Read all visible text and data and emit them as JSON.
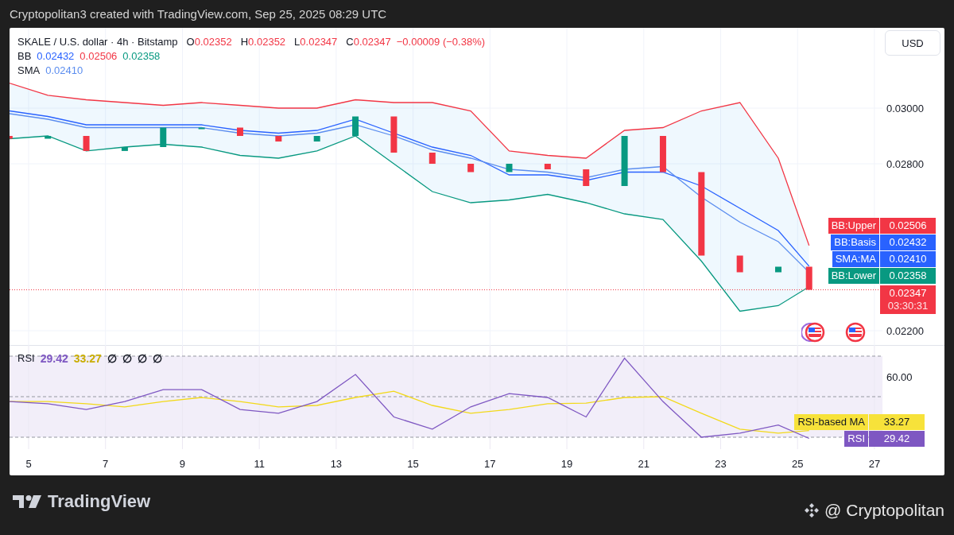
{
  "header": {
    "text": "Cryptopolitan3 created with TradingView.com, Sep 25, 2025 08:29 UTC"
  },
  "legend": {
    "symbol": "SKALE / U.S. dollar · 4h · Bitstamp",
    "ohlc": [
      {
        "label": "O",
        "value": "0.02352"
      },
      {
        "label": "H",
        "value": "0.02352"
      },
      {
        "label": "L",
        "value": "0.02347"
      },
      {
        "label": "C",
        "value": "0.02347"
      }
    ],
    "change": "−0.00009 (−0.38%)",
    "indicators": [
      {
        "name": "BB",
        "values": [
          {
            "text": "0.02432",
            "color": "#2962ff"
          },
          {
            "text": "0.02506",
            "color": "#f23645"
          },
          {
            "text": "0.02358",
            "color": "#089981"
          }
        ]
      },
      {
        "name": "SMA",
        "values": [
          {
            "text": "0.02410",
            "color": "#5b8def"
          }
        ]
      }
    ]
  },
  "currency": "USD",
  "price_axis": [
    "0.03000",
    "0.02800",
    "0.02200"
  ],
  "price_labels": [
    {
      "name": "BB:Upper",
      "value": "0.02506",
      "color": "#f23645"
    },
    {
      "name": "BB:Basis",
      "value": "0.02432",
      "color": "#2962ff"
    },
    {
      "name": "SMA:MA",
      "value": "0.02410",
      "color": "#2962ff"
    },
    {
      "name": "BB:Lower",
      "value": "0.02358",
      "color": "#089981"
    }
  ],
  "last_price": {
    "value": "0.02347",
    "countdown": "03:30:31"
  },
  "rsi": {
    "legend": {
      "name": "RSI",
      "values": [
        {
          "text": "29.42",
          "color": "#7e57c2"
        },
        {
          "text": "33.27",
          "color": "#c9ad00"
        },
        {
          "text": "∅",
          "color": "#131722"
        },
        {
          "text": "∅",
          "color": "#131722"
        },
        {
          "text": "∅",
          "color": "#131722"
        },
        {
          "text": "∅",
          "color": "#131722"
        }
      ]
    },
    "axis": [
      "60.00"
    ],
    "labels": [
      {
        "name": "RSI-based MA",
        "value": "33.27",
        "color": "#f7e23a"
      },
      {
        "name": "RSI",
        "value": "29.42",
        "color": "#7e57c2"
      }
    ]
  },
  "time_axis": [
    "5",
    "7",
    "9",
    "11",
    "13",
    "15",
    "17",
    "19",
    "21",
    "23",
    "25",
    "27"
  ],
  "footer": {
    "logo": "TradingView",
    "credit": "@ Cryptopolitan"
  }
}
